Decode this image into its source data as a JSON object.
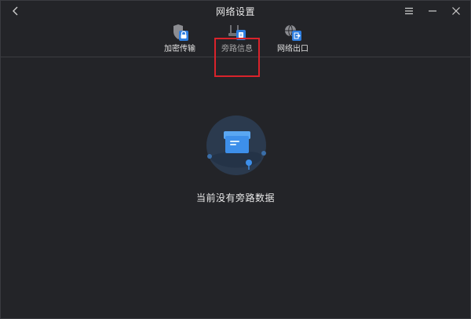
{
  "window": {
    "title": "网络设置"
  },
  "tabs": [
    {
      "id": "encrypt",
      "label": "加密传输",
      "icon": "shield-lock-icon"
    },
    {
      "id": "bypass",
      "label": "旁路信息",
      "icon": "bypass-router-icon",
      "active": true
    },
    {
      "id": "exit",
      "label": "网络出口",
      "icon": "globe-exit-icon"
    }
  ],
  "empty_state": {
    "message": "当前没有旁路数据",
    "icon": "empty-box-icon"
  },
  "colors": {
    "background": "#232428",
    "accent": "#2f7fe0",
    "highlight": "#d9232b"
  }
}
